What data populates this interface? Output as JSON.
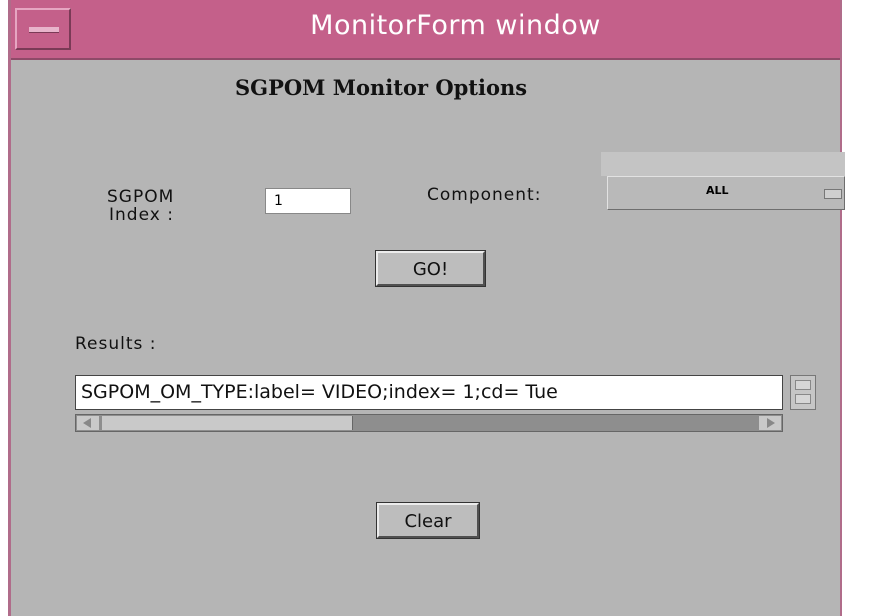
{
  "window": {
    "title": "MonitorForm window",
    "heading": "SGPOM Monitor Options"
  },
  "form": {
    "index_label_line1": "SGPOM",
    "index_label_line2": "Index :",
    "index_value": "1",
    "component_label": "Component:",
    "component_value": "ALL",
    "go_label": "GO!",
    "results_label": "Results :",
    "results_text": "SGPOM_OM_TYPE:label= VIDEO;index= 1;cd= Tue",
    "clear_label": "Clear"
  },
  "colors": {
    "titlebar": "#c4608a",
    "background": "#b5b5b5"
  },
  "icons": {
    "window_menu": "window-menu-icon",
    "spin": "spin-arrows-icon",
    "scroll_left": "scroll-left-icon",
    "scroll_right": "scroll-right-icon"
  }
}
